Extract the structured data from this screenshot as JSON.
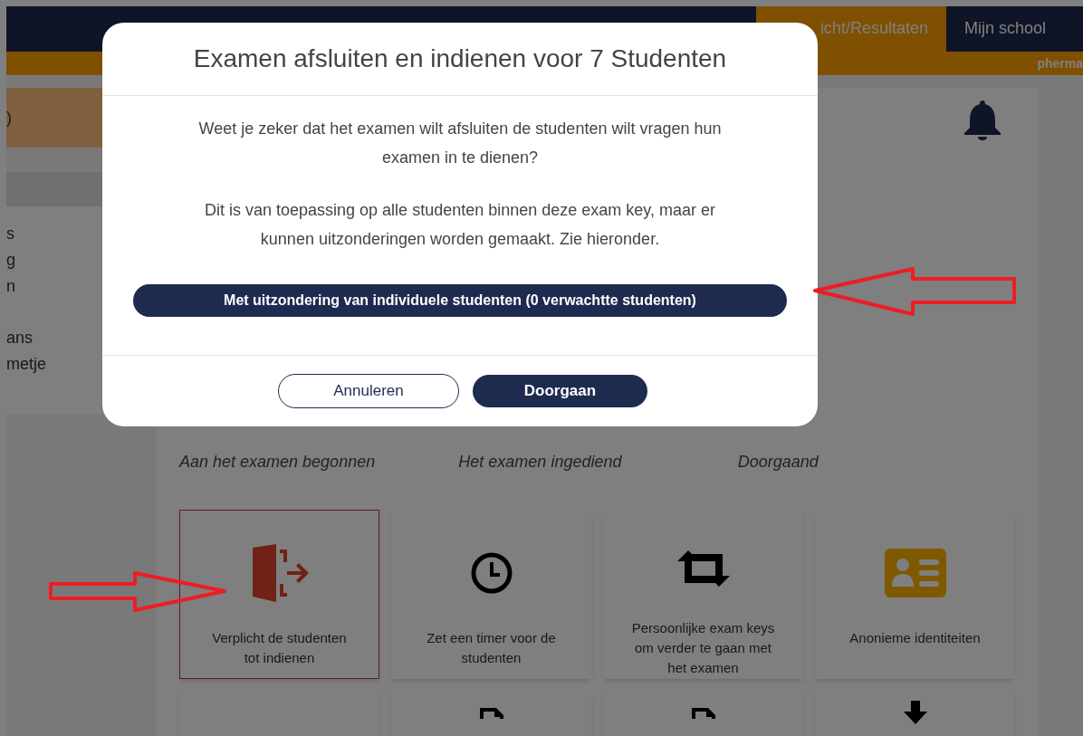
{
  "header": {
    "tabs": [
      {
        "label": "icht/Resultaten",
        "selected": true
      },
      {
        "label": "Mijn school",
        "selected": false
      }
    ],
    "user": "pherma"
  },
  "sidebar": {
    "banner": ")",
    "groups": [
      [
        "s",
        "g",
        "n"
      ],
      [
        "ans",
        "metje"
      ]
    ]
  },
  "status_labels": [
    "Aan het examen begonnen",
    "Het examen ingediend",
    "Doorgaand"
  ],
  "tiles": [
    {
      "kind": "exit",
      "label": "Verplicht de studenten tot indienen",
      "selected": true
    },
    {
      "kind": "clock",
      "label": "Zet een timer voor de studenten",
      "selected": false
    },
    {
      "kind": "swap",
      "label": "Persoonlijke exam keys om verder te gaan met het examen",
      "selected": false
    },
    {
      "kind": "idcard",
      "label": "Anonieme identiteiten",
      "selected": false
    },
    {
      "kind": "blank",
      "selected": false
    },
    {
      "kind": "file",
      "selected": false
    },
    {
      "kind": "file",
      "selected": false
    },
    {
      "kind": "download",
      "selected": false
    }
  ],
  "dialog": {
    "title": "Examen afsluiten en indienen voor 7 Studenten",
    "paragraphs": [
      "Weet je zeker dat het examen wilt afsluiten de studenten wilt vragen hun examen in te dienen?",
      "Dit is van toepassing op alle studenten binnen deze exam key, maar er kunnen uitzonderingen worden gemaakt. Zie hieronder."
    ],
    "exception_button": "Met uitzondering van individuele studenten (0 verwachtte studenten)",
    "cancel": "Annuleren",
    "confirm": "Doorgaan"
  }
}
